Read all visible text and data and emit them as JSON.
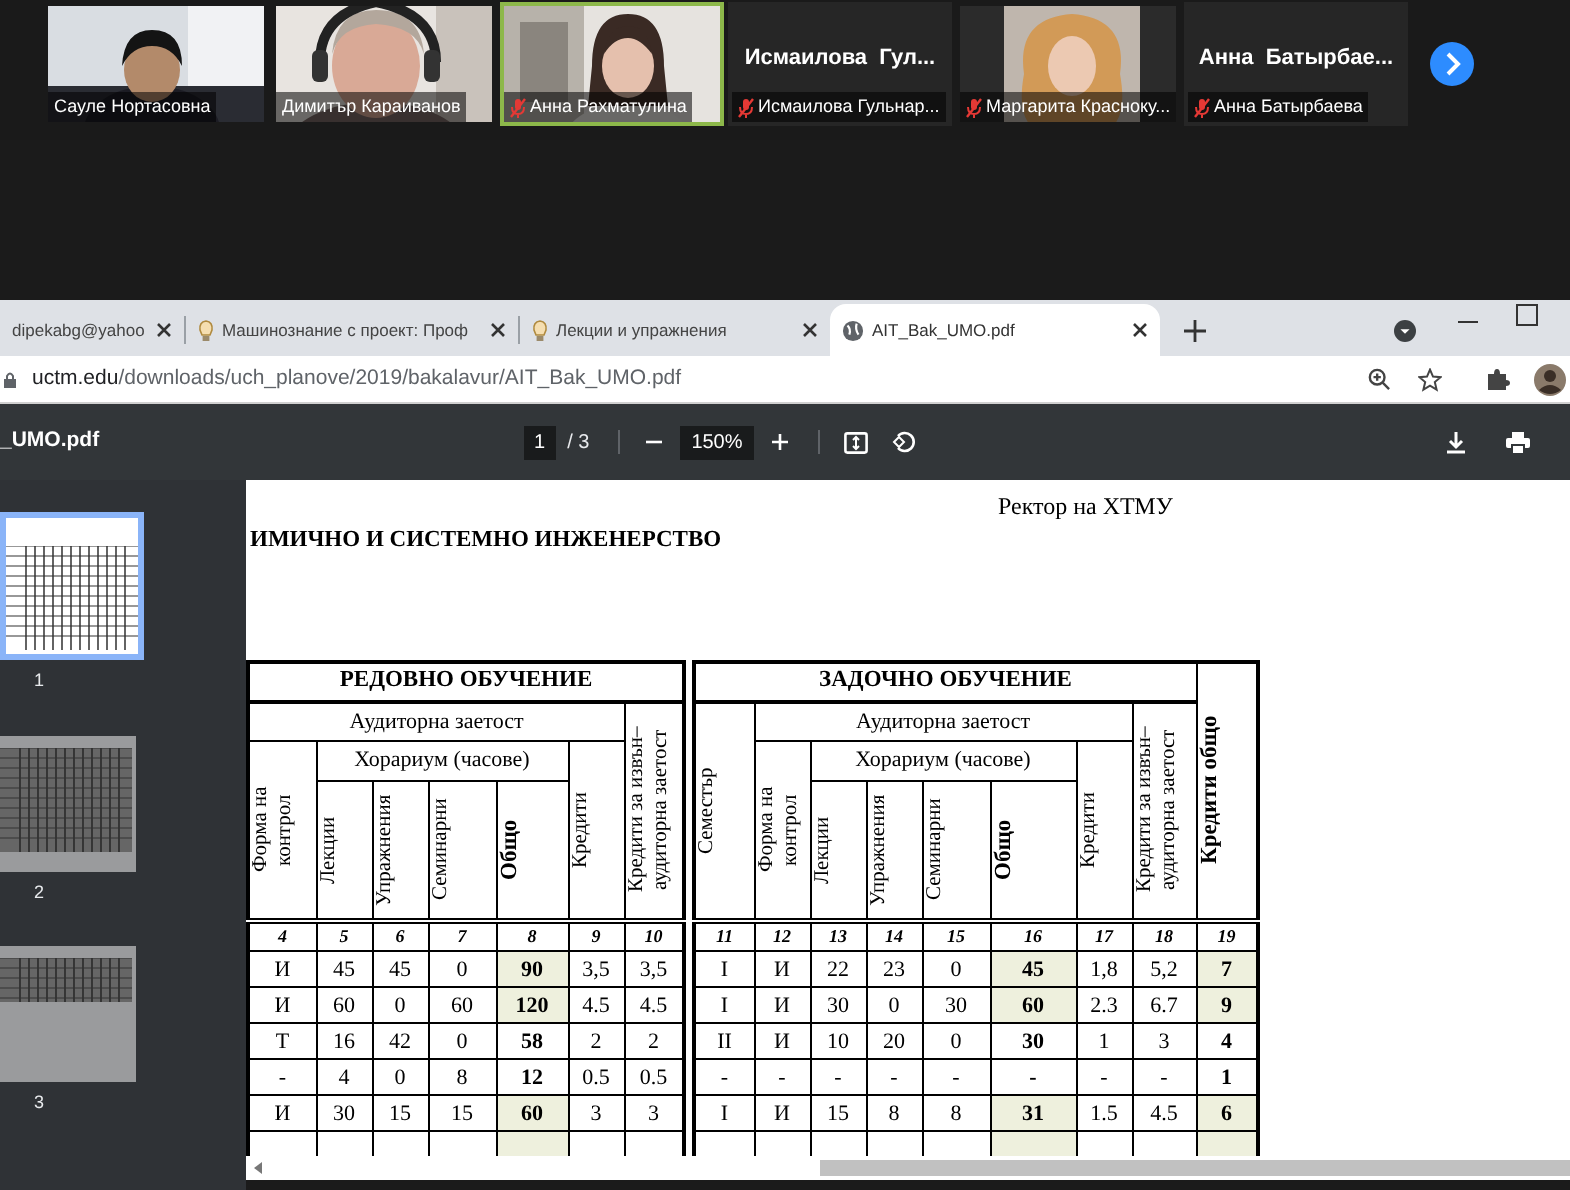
{
  "meeting": {
    "participants": [
      {
        "kind": "video",
        "name": "Сауле Нортасовна",
        "muted": false,
        "highlighted": false
      },
      {
        "kind": "video",
        "name": "Димитър Караиванов",
        "muted": false,
        "highlighted": false
      },
      {
        "kind": "video",
        "name": "Анна Рахматулина",
        "muted": true,
        "highlighted": true
      },
      {
        "kind": "name",
        "display": "Исмаилова  Гул...",
        "name": "Исмаилова Гульнар...",
        "muted": true,
        "highlighted": false
      },
      {
        "kind": "video",
        "name": "Маргарита Красноку...",
        "muted": true,
        "highlighted": false
      },
      {
        "kind": "name",
        "display": "Анна  Батырбае...",
        "name": "Анна Батырбаева",
        "muted": true,
        "highlighted": false
      }
    ]
  },
  "browser": {
    "tabs": [
      {
        "title": "dipekabg@yahoo",
        "kind": "mail",
        "selected": false
      },
      {
        "title": "Машинознание с проект: Проф",
        "kind": "course",
        "selected": false
      },
      {
        "title": "Лекции и упражнения",
        "kind": "course",
        "selected": false
      },
      {
        "title": "AIT_Bak_UMO.pdf",
        "kind": "file",
        "selected": true
      }
    ],
    "address": {
      "host": "uctm.edu",
      "path": "/downloads/uch_planove/2019/bakalavur/AIT_Bak_UMO.pdf"
    }
  },
  "pdf_viewer": {
    "file_name": "_UMO.pdf",
    "page": "1",
    "page_count": "/ 3",
    "zoom": "150%",
    "thumbnails": [
      {
        "label": "1",
        "selected": true
      },
      {
        "label": "2",
        "selected": false
      },
      {
        "label": "3",
        "selected": false
      }
    ],
    "document": {
      "header_right": "Ректор на ХТМУ",
      "heading": "ИМИЧНО И СИСТЕМНО ИНЖЕНЕРСТВО",
      "sections": [
        {
          "title": "РЕДОВНО ОБУЧЕНИЕ",
          "group": "Аудиторна заетост",
          "hours": "Хорариум (часове)",
          "columns": [
            {
              "kind": "form",
              "label": "Форма на контрол",
              "number": "4"
            },
            {
              "kind": "hour",
              "label": "Лекции",
              "number": "5"
            },
            {
              "kind": "hour",
              "label": "Упражнения",
              "number": "6"
            },
            {
              "kind": "hour",
              "label": "Семинарни",
              "number": "7"
            },
            {
              "kind": "total",
              "label": "Общо",
              "number": "8"
            },
            {
              "kind": "credit",
              "label": "Кредити",
              "number": "9"
            },
            {
              "kind": "extra",
              "label": "Кредити за извън–аудиторна заетост",
              "number": "10"
            }
          ],
          "rows": [
            {
              "shaded": true,
              "cells": [
                "И",
                "45",
                "45",
                "0",
                "90",
                "3,5",
                "3,5"
              ]
            },
            {
              "shaded": true,
              "cells": [
                "И",
                "60",
                "0",
                "60",
                "120",
                "4.5",
                "4.5"
              ]
            },
            {
              "shaded": false,
              "cells": [
                "Т",
                "16",
                "42",
                "0",
                "58",
                "2",
                "2"
              ]
            },
            {
              "shaded": false,
              "cells": [
                "-",
                "4",
                "0",
                "8",
                "12",
                "0.5",
                "0.5"
              ]
            },
            {
              "shaded": true,
              "cells": [
                "И",
                "30",
                "15",
                "15",
                "60",
                "3",
                "3"
              ]
            },
            {
              "shaded": true
            }
          ]
        },
        {
          "title": "ЗАДОЧНО ОБУЧЕНИЕ",
          "group": "Аудиторна заетост",
          "hours": "Хорариум (часове)",
          "columns": [
            {
              "kind": "semester",
              "label": "Семестър",
              "number": "11"
            },
            {
              "kind": "form",
              "label": "Форма на контрол",
              "number": "12"
            },
            {
              "kind": "hour",
              "label": "Лекции",
              "number": "13"
            },
            {
              "kind": "hour",
              "label": "Упражнения",
              "number": "14"
            },
            {
              "kind": "hour",
              "label": "Семинарни",
              "number": "15"
            },
            {
              "kind": "total",
              "label": "Общо",
              "number": "16"
            },
            {
              "kind": "credit",
              "label": "Кредити",
              "number": "17"
            },
            {
              "kind": "extra",
              "label": "Кредити за извън–аудиторна заетост",
              "number": "18"
            },
            {
              "kind": "grand",
              "label": "Кредити общо",
              "number": "19"
            }
          ],
          "rows": [
            {
              "shaded": true,
              "cells": [
                "I",
                "И",
                "22",
                "23",
                "0",
                "45",
                "1,8",
                "5,2",
                "7"
              ]
            },
            {
              "shaded": true,
              "cells": [
                "I",
                "И",
                "30",
                "0",
                "30",
                "60",
                "2.3",
                "6.7",
                "9"
              ]
            },
            {
              "shaded": false,
              "cells": [
                "II",
                "И",
                "10",
                "20",
                "0",
                "30",
                "1",
                "3",
                "4"
              ]
            },
            {
              "shaded": false,
              "cells": [
                "-",
                "-",
                "-",
                "-",
                "-",
                "-",
                "-",
                "-",
                "1"
              ]
            },
            {
              "shaded": true,
              "cells": [
                "I",
                "И",
                "15",
                "8",
                "8",
                "31",
                "1.5",
                "4.5",
                "6"
              ]
            },
            {
              "shaded": true
            }
          ]
        }
      ]
    }
  }
}
